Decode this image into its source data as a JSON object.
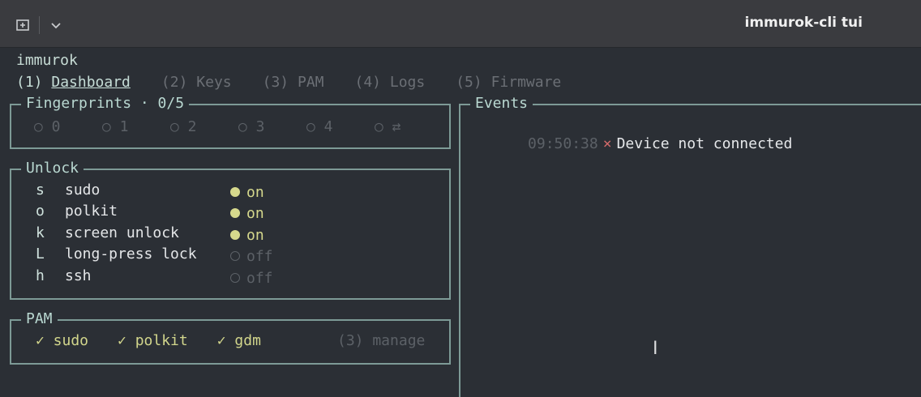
{
  "titlebar": {
    "new_tab_icon": "new-tab-icon",
    "dropdown_icon": "chevron-down-icon",
    "title": "immurok-cli tui"
  },
  "app": {
    "name": "immurok"
  },
  "tabs": [
    {
      "key": "(1)",
      "label": "Dashboard",
      "active": true
    },
    {
      "key": "(2)",
      "label": "Keys",
      "active": false
    },
    {
      "key": "(3)",
      "label": "PAM",
      "active": false
    },
    {
      "key": "(4)",
      "label": "Logs",
      "active": false
    },
    {
      "key": "(5)",
      "label": "Firmware",
      "active": false
    }
  ],
  "fingerprints": {
    "title": "Fingerprints · 0/5",
    "slots": [
      "○ 0",
      "○ 1",
      "○ 2",
      "○ 3",
      "○ 4",
      "○ ⇄"
    ]
  },
  "unlock": {
    "title": "Unlock",
    "rows": [
      {
        "key": "s",
        "label": "sudo",
        "status": "on"
      },
      {
        "key": "o",
        "label": "polkit",
        "status": "on"
      },
      {
        "key": "k",
        "label": "screen unlock",
        "status": "on"
      },
      {
        "key": "L",
        "label": "long-press lock",
        "status": "off"
      },
      {
        "key": "h",
        "label": "ssh",
        "status": "off"
      }
    ]
  },
  "pam": {
    "title": "PAM",
    "items": [
      "✓ sudo",
      "✓ polkit",
      "✓ gdm"
    ],
    "manage": "(3) manage"
  },
  "events": {
    "title": "Events",
    "entries": [
      {
        "time": "09:50:38",
        "mark": "×",
        "message": "Device not connected"
      }
    ]
  },
  "colors": {
    "background": "#2b2f35",
    "border": "#7d9a96",
    "on": "#d6d98d",
    "error": "#d26a6a",
    "muted": "#5c6167"
  }
}
